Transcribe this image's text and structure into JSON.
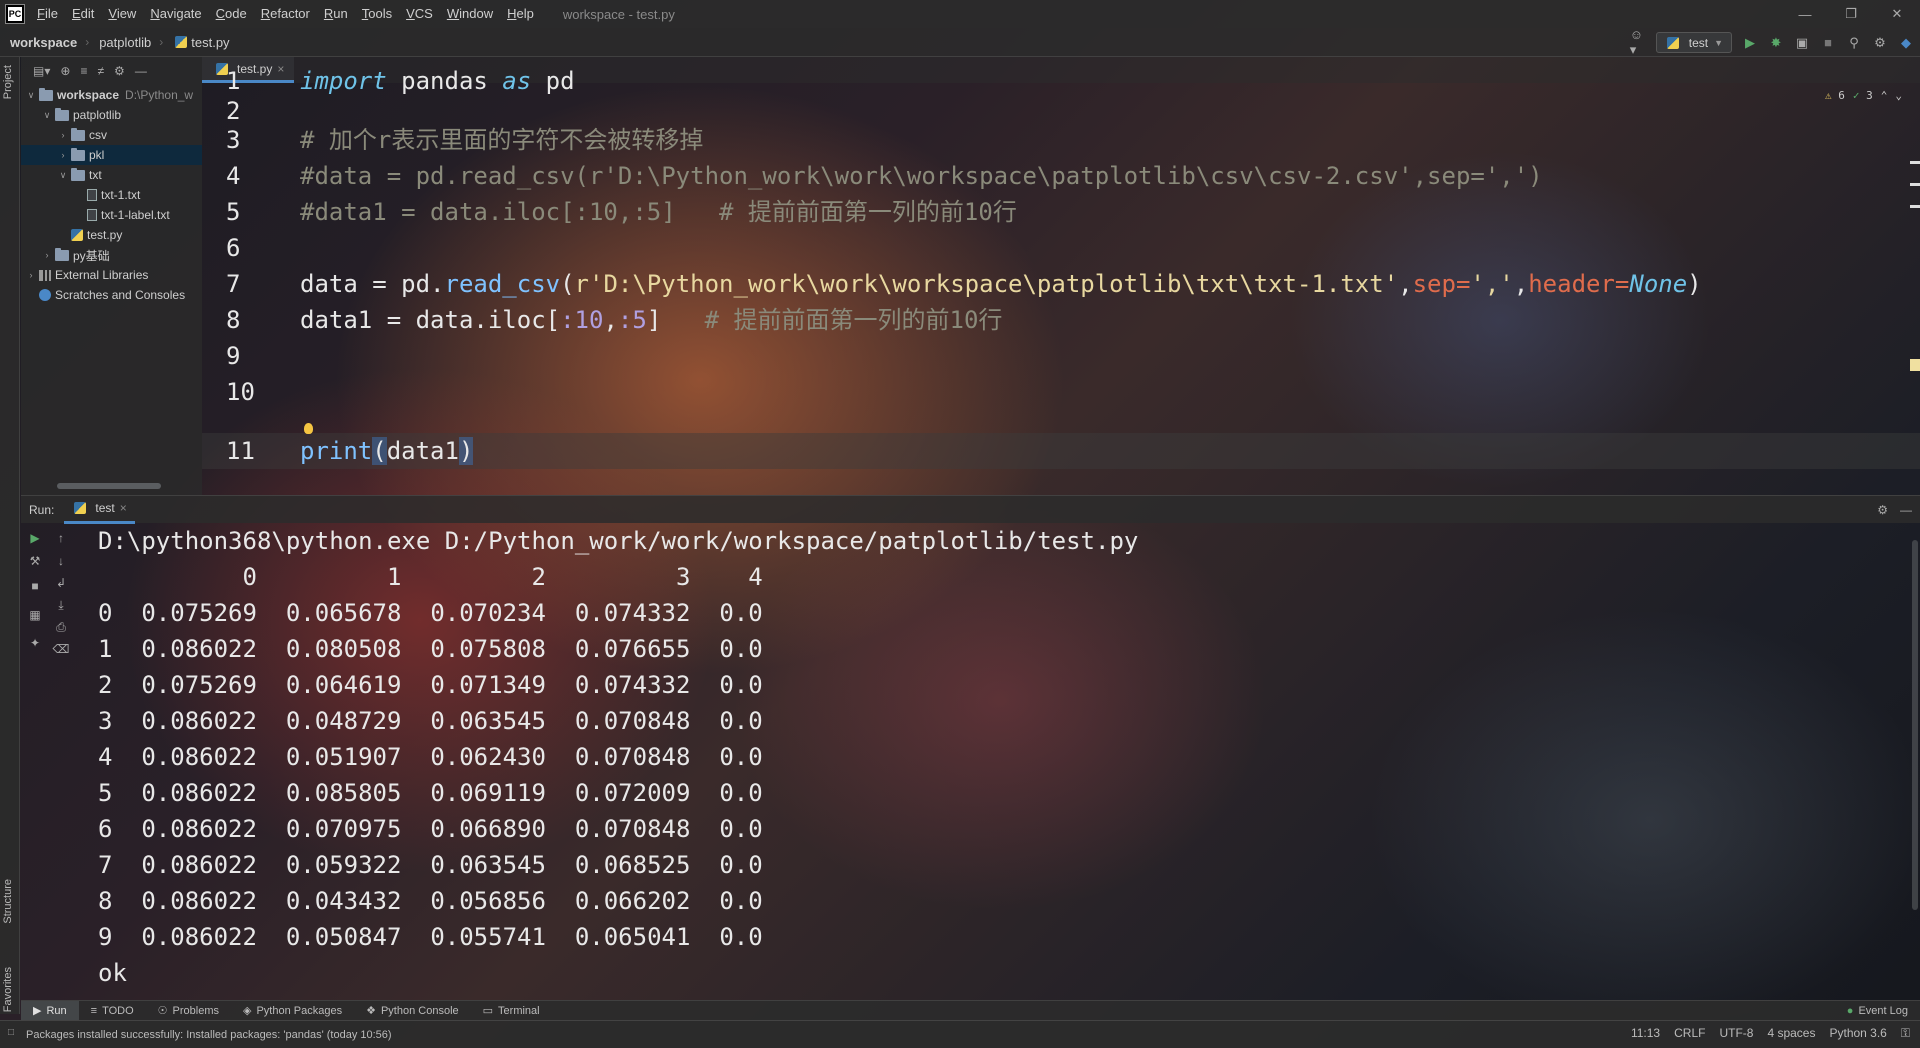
{
  "menubar": {
    "logo": "PC",
    "items": [
      "File",
      "Edit",
      "View",
      "Navigate",
      "Code",
      "Refactor",
      "Run",
      "Tools",
      "VCS",
      "Window",
      "Help"
    ],
    "window_title": "workspace - test.py"
  },
  "navbar": {
    "breadcrumbs": [
      "workspace",
      "patplotlib",
      "test.py"
    ],
    "run_config": "test"
  },
  "left_strip": {
    "project": "Project",
    "structure": "Structure",
    "favorites": "Favorites"
  },
  "project": {
    "tree": [
      {
        "label": "workspace",
        "path": "D:\\Python_w",
        "indent": 0,
        "arrow": "v",
        "icon": "folder",
        "bold": true
      },
      {
        "label": "patplotlib",
        "indent": 1,
        "arrow": "v",
        "icon": "folder"
      },
      {
        "label": "csv",
        "indent": 2,
        "arrow": ">",
        "icon": "folder"
      },
      {
        "label": "pkl",
        "indent": 2,
        "arrow": ">",
        "icon": "folder",
        "selected": true
      },
      {
        "label": "txt",
        "indent": 2,
        "arrow": "v",
        "icon": "folder"
      },
      {
        "label": "txt-1.txt",
        "indent": 3,
        "arrow": "",
        "icon": "file"
      },
      {
        "label": "txt-1-label.txt",
        "indent": 3,
        "arrow": "",
        "icon": "file"
      },
      {
        "label": "test.py",
        "indent": 2,
        "arrow": "",
        "icon": "py"
      },
      {
        "label": "py基础",
        "indent": 1,
        "arrow": ">",
        "icon": "folder"
      },
      {
        "label": "External Libraries",
        "indent": 0,
        "arrow": ">",
        "icon": "lib"
      },
      {
        "label": "Scratches and Consoles",
        "indent": 0,
        "arrow": "",
        "icon": "scratch"
      }
    ]
  },
  "editor": {
    "tab_label": "test.py",
    "inspection": {
      "warnings": "6",
      "weak_warnings": "3"
    },
    "line_numbers": [
      "1",
      "2",
      "3",
      "4",
      "5",
      "6",
      "7",
      "8",
      "9",
      "10",
      "11"
    ],
    "code": {
      "l1_import": "import",
      "l1_pandas": " pandas ",
      "l1_as": "as",
      "l1_pd": " pd",
      "l3": "# 加个r表示里面的字符不会被转移掉",
      "l4": "#data = pd.read_csv(r'D:\\Python_work\\work\\workspace\\patplotlib\\csv\\csv-2.csv',sep=',')",
      "l5": "#data1 = data.iloc[:10,:5]   # 提前前面第一列的前10行",
      "l7_a": "data = pd.",
      "l7_fn": "read_csv",
      "l7_b": "(",
      "l7_str": "r'D:\\Python_work\\work\\workspace\\patplotlib\\txt\\txt-1.txt'",
      "l7_c": ",",
      "l7_sep": "sep=",
      "l7_sepval": "','",
      "l7_d": ",",
      "l7_header": "header=",
      "l7_none": "None",
      "l7_e": ")",
      "l8_a": "data1 = data.iloc[",
      "l8_n1": ":10",
      "l8_b": ",",
      "l8_n2": ":5",
      "l8_c": "]",
      "l8_cmt": "   # 提前前面第一列的前10行",
      "l11_fn": "print",
      "l11_open": "(",
      "l11_arg": "data1",
      "l11_close": ")"
    }
  },
  "run": {
    "label": "Run:",
    "tab": "test",
    "console": [
      "D:\\python368\\python.exe D:/Python_work/work/workspace/patplotlib/test.py",
      "          0         1         2         3    4",
      "0  0.075269  0.065678  0.070234  0.074332  0.0",
      "1  0.086022  0.080508  0.075808  0.076655  0.0",
      "2  0.075269  0.064619  0.071349  0.074332  0.0",
      "3  0.086022  0.048729  0.063545  0.070848  0.0",
      "4  0.086022  0.051907  0.062430  0.070848  0.0",
      "5  0.086022  0.085805  0.069119  0.072009  0.0",
      "6  0.086022  0.070975  0.066890  0.070848  0.0",
      "7  0.086022  0.059322  0.063545  0.068525  0.0",
      "8  0.086022  0.043432  0.056856  0.066202  0.0",
      "9  0.086022  0.050847  0.055741  0.065041  0.0",
      "ok"
    ]
  },
  "bottom_tabs": {
    "run": "Run",
    "todo": "TODO",
    "problems": "Problems",
    "packages": "Python Packages",
    "console": "Python Console",
    "terminal": "Terminal",
    "event_log": "Event Log"
  },
  "status": {
    "message": "Packages installed successfully: Installed packages: 'pandas' (today 10:56)",
    "position": "11:13",
    "line_sep": "CRLF",
    "encoding": "UTF-8",
    "indent": "4 spaces",
    "interpreter": "Python 3.6"
  }
}
